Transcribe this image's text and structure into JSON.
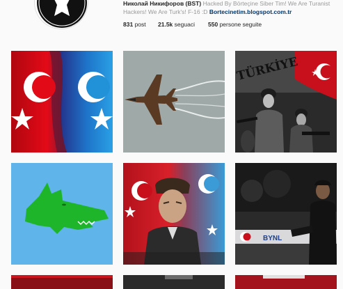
{
  "profile": {
    "display_name": "Николай Никифоров (BST)",
    "bio_text": "Hacked By Börteçine Siber Tim! We Are Turanist Hackers! We Are Turk's! F-16 :D",
    "link": "Bortecinetim.blogspot.com.tr",
    "stats": [
      {
        "value": "831",
        "label": "post"
      },
      {
        "value": "21.5k",
        "label": "seguaci"
      },
      {
        "value": "550",
        "label": "persone seguite"
      }
    ]
  },
  "posts": [
    {
      "name": "post-flags-turkey-turan"
    },
    {
      "name": "post-f16-jet"
    },
    {
      "name": "post-turkiye-soldiers",
      "caption": "TÜRKİYE"
    },
    {
      "name": "post-grey-wolf-head"
    },
    {
      "name": "post-ataturk-flags"
    },
    {
      "name": "post-man-sitting-night",
      "caption": "BYNL"
    }
  ],
  "colors": {
    "turk_red": "#e30a17",
    "turan_blue": "#1e73c8",
    "wolf_green": "#1fb52b",
    "wolf_bg": "#5fb4ea",
    "link_color": "#003569"
  }
}
